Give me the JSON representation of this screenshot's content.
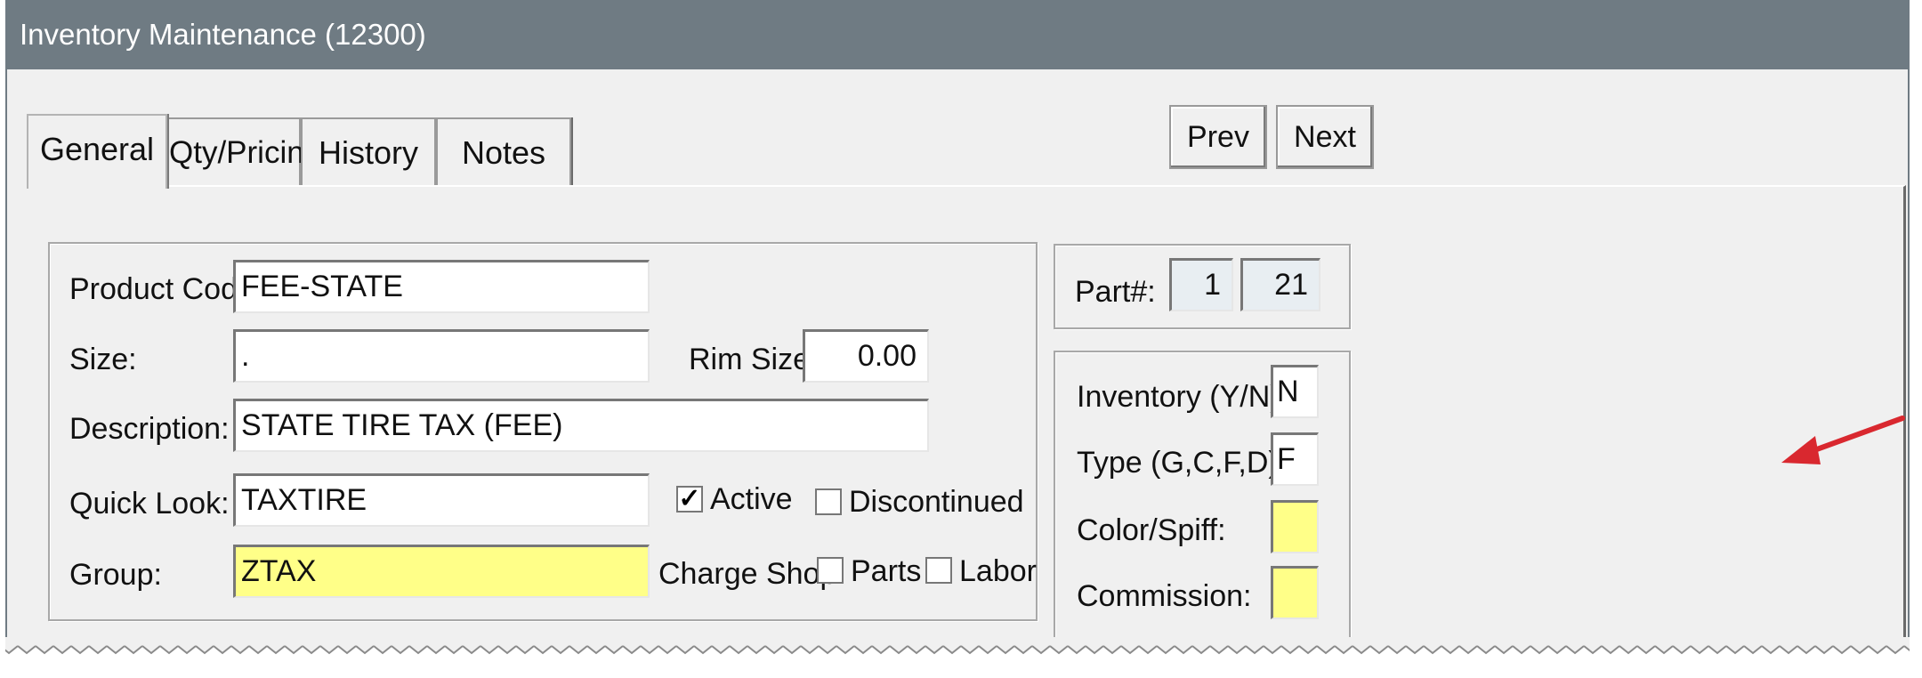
{
  "window": {
    "title": "Inventory Maintenance (12300)"
  },
  "tabs": [
    {
      "label": "General",
      "active": true
    },
    {
      "label": "Qty/Pricing",
      "active": false
    },
    {
      "label": "History",
      "active": false
    },
    {
      "label": "Notes",
      "active": false
    }
  ],
  "nav": {
    "prev_label": "Prev",
    "next_label": "Next"
  },
  "form": {
    "product_code": {
      "label": "Product Code:",
      "value": "FEE-STATE"
    },
    "size": {
      "label": "Size:",
      "value": "."
    },
    "rim_size": {
      "label": "Rim Size:",
      "value": "0.00"
    },
    "description": {
      "label": "Description:",
      "value": "STATE TIRE TAX (FEE)"
    },
    "quick_look": {
      "label": "Quick Look:",
      "value": "TAXTIRE"
    },
    "group": {
      "label": "Group:",
      "value": "ZTAX"
    },
    "active": {
      "label": "Active",
      "checked": true
    },
    "discontinued": {
      "label": "Discontinued",
      "checked": false
    },
    "charge_shop": {
      "label": "Charge Shop:",
      "parts": {
        "label": "Parts",
        "checked": false
      },
      "labor": {
        "label": "Labor",
        "checked": false
      }
    }
  },
  "part": {
    "label": "Part#:",
    "value1": "1",
    "value2": "21"
  },
  "settings": {
    "inventory": {
      "label": "Inventory (Y/N):",
      "value": "N"
    },
    "type": {
      "label": "Type (G,C,F,D):",
      "value": "F"
    },
    "color_spiff": {
      "label": "Color/Spiff:",
      "value": ""
    },
    "commission": {
      "label": "Commission:",
      "value": ""
    }
  },
  "colors": {
    "titlebar": "#6f7b83",
    "highlight_field": "#ffff88",
    "annotation_arrow": "#d9282f"
  }
}
